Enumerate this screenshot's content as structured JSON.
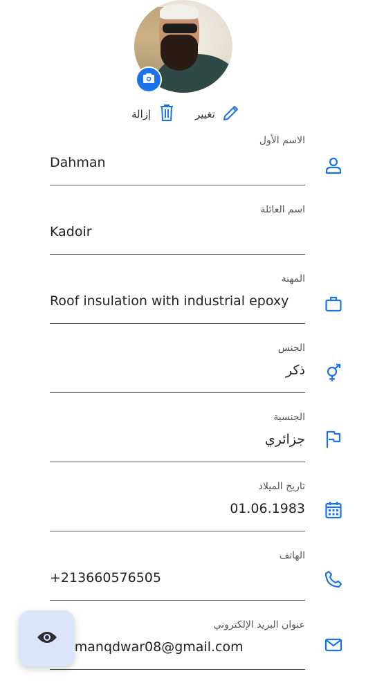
{
  "photo_actions": {
    "remove_label": "إزالة",
    "change_label": "تغيير"
  },
  "fields": [
    {
      "label": "الاسم الأول",
      "value": "Dahman"
    },
    {
      "label": "اسم العائلة",
      "value": "Kadoir"
    },
    {
      "label": "المهنة",
      "value": "Roof insulation with industrial epoxy"
    },
    {
      "label": "الجنس",
      "value": "ذكر"
    },
    {
      "label": "الجنسية",
      "value": "جزائري"
    },
    {
      "label": "تاريخ الميلاد",
      "value": "01.06.1983"
    },
    {
      "label": "الهاتف",
      "value": "+213660576505"
    },
    {
      "label": "عنوان البريد الإلكتروني",
      "value": "dahmanqdwar08@gmail.com"
    }
  ],
  "icons": {
    "first_name": "person-icon",
    "occupation": "briefcase-icon",
    "gender": "gender-icon",
    "nationality": "flag-icon",
    "birthdate": "calendar-icon",
    "phone": "phone-icon",
    "email": "mail-icon",
    "camera": "camera-icon",
    "fab": "eye-icon",
    "remove": "trash-icon",
    "change": "pencil-icon"
  },
  "colors": {
    "accent": "#1a73e8",
    "fab_bg": "#dbe6fb",
    "underline": "#555555"
  }
}
